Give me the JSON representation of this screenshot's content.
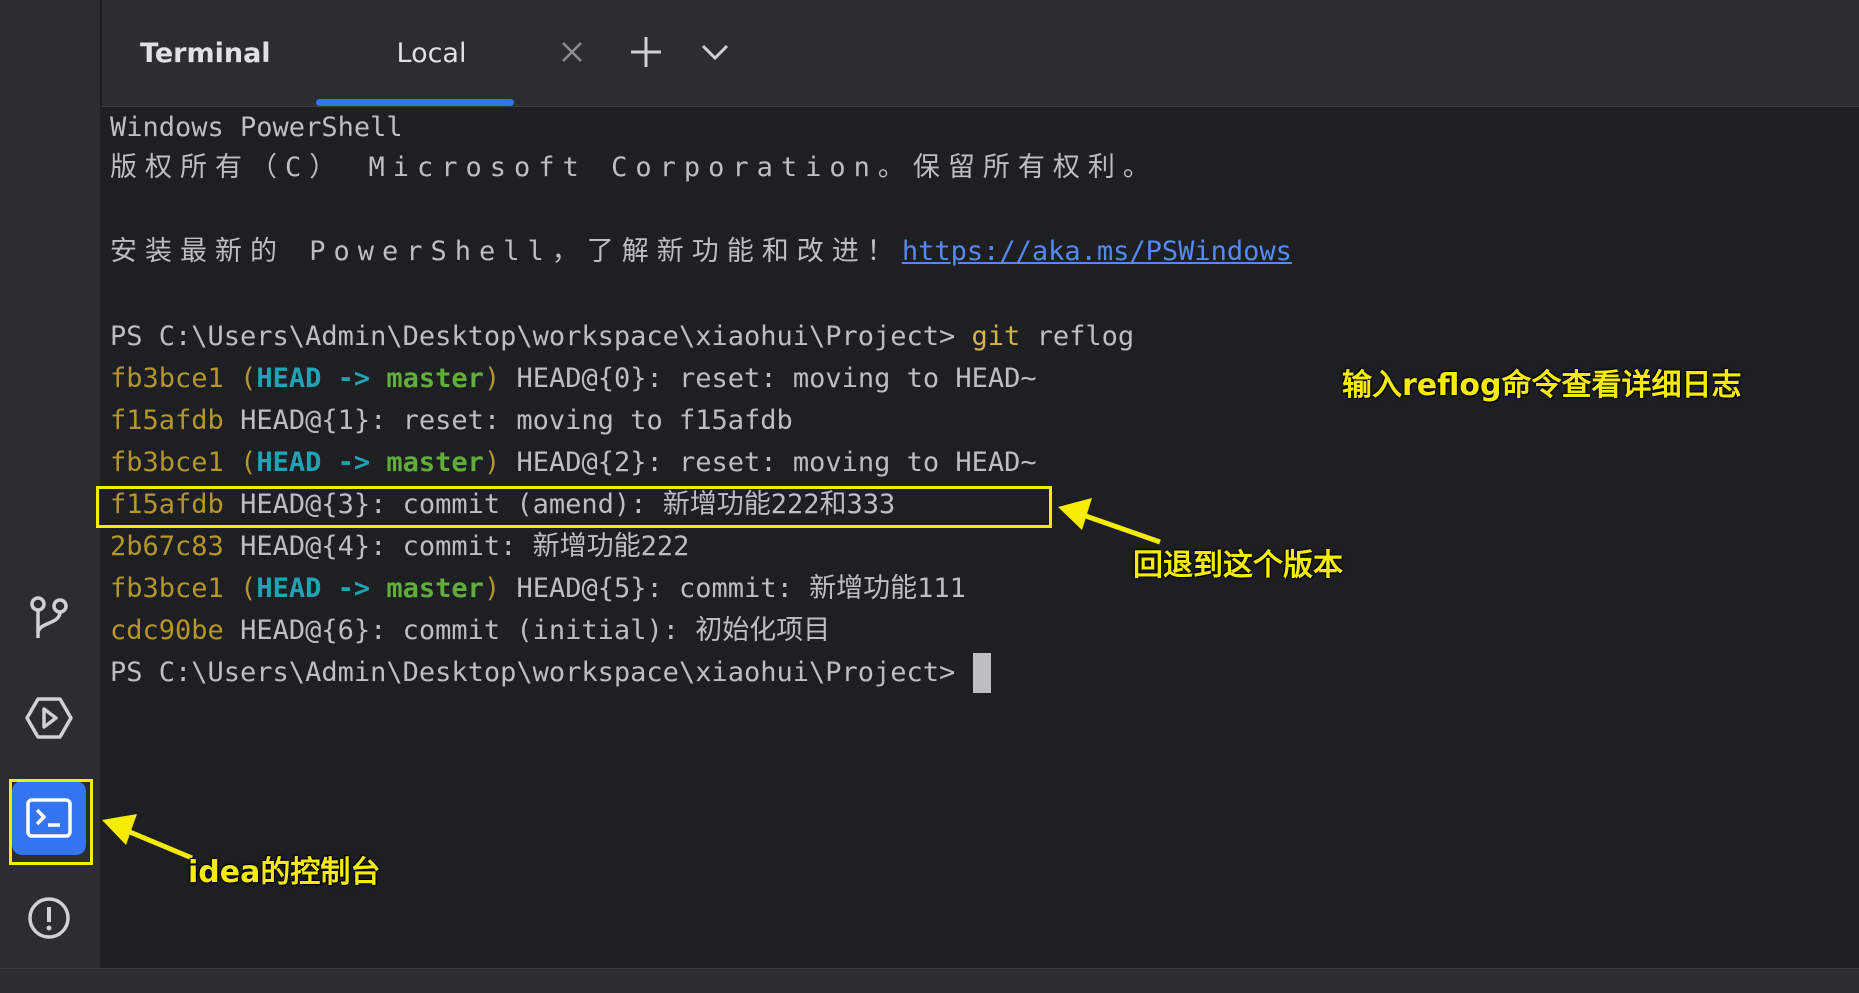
{
  "header": {
    "title": "Terminal",
    "tabs": [
      {
        "label": "Local"
      }
    ]
  },
  "icons": {
    "git": "git-branch-icon",
    "run": "run-icon",
    "terminal": "terminal-icon",
    "problems": "problems-icon",
    "close": "close-icon",
    "add": "plus-icon",
    "more": "chevron-down-icon"
  },
  "colors": {
    "accent": "#3574f0",
    "annotation": "#f6ec00",
    "hash": "#b5952c",
    "head": "#21a3b5",
    "branch": "#5fae3c"
  },
  "terminal": {
    "banner1": "Windows PowerShell",
    "banner2": "版权所有（C） Microsoft Corporation。保留所有权利。",
    "install_prefix": "安装最新的 PowerShell，了解新功能和改进！",
    "install_link": "https://aka.ms/PSWindows",
    "prompt": "PS C:\\Users\\Admin\\Desktop\\workspace\\xiaohui\\Project>",
    "command_git": "git",
    "command_arg": "reflog",
    "reflog": [
      {
        "hash": "fb3bce1",
        "ref": true,
        "head": "HEAD",
        "arrow": "->",
        "branch": "master",
        "text": "HEAD@{0}: reset: moving to HEAD~"
      },
      {
        "hash": "f15afdb",
        "ref": false,
        "text": "HEAD@{1}: reset: moving to f15afdb"
      },
      {
        "hash": "fb3bce1",
        "ref": true,
        "head": "HEAD",
        "arrow": "->",
        "branch": "master",
        "text": "HEAD@{2}: reset: moving to HEAD~"
      },
      {
        "hash": "f15afdb",
        "ref": false,
        "text": "HEAD@{3}: commit (amend): 新增功能222和333"
      },
      {
        "hash": "2b67c83",
        "ref": false,
        "text": "HEAD@{4}: commit: 新增功能222"
      },
      {
        "hash": "fb3bce1",
        "ref": true,
        "head": "HEAD",
        "arrow": "->",
        "branch": "master",
        "text": "HEAD@{5}: commit: 新增功能111"
      },
      {
        "hash": "cdc90be",
        "ref": false,
        "text": "HEAD@{6}: commit (initial): 初始化项目"
      }
    ]
  },
  "annotations": {
    "reflog_note": "输入reflog命令查看详细日志",
    "rollback_note": "回退到这个版本",
    "console_note": "idea的控制台"
  }
}
